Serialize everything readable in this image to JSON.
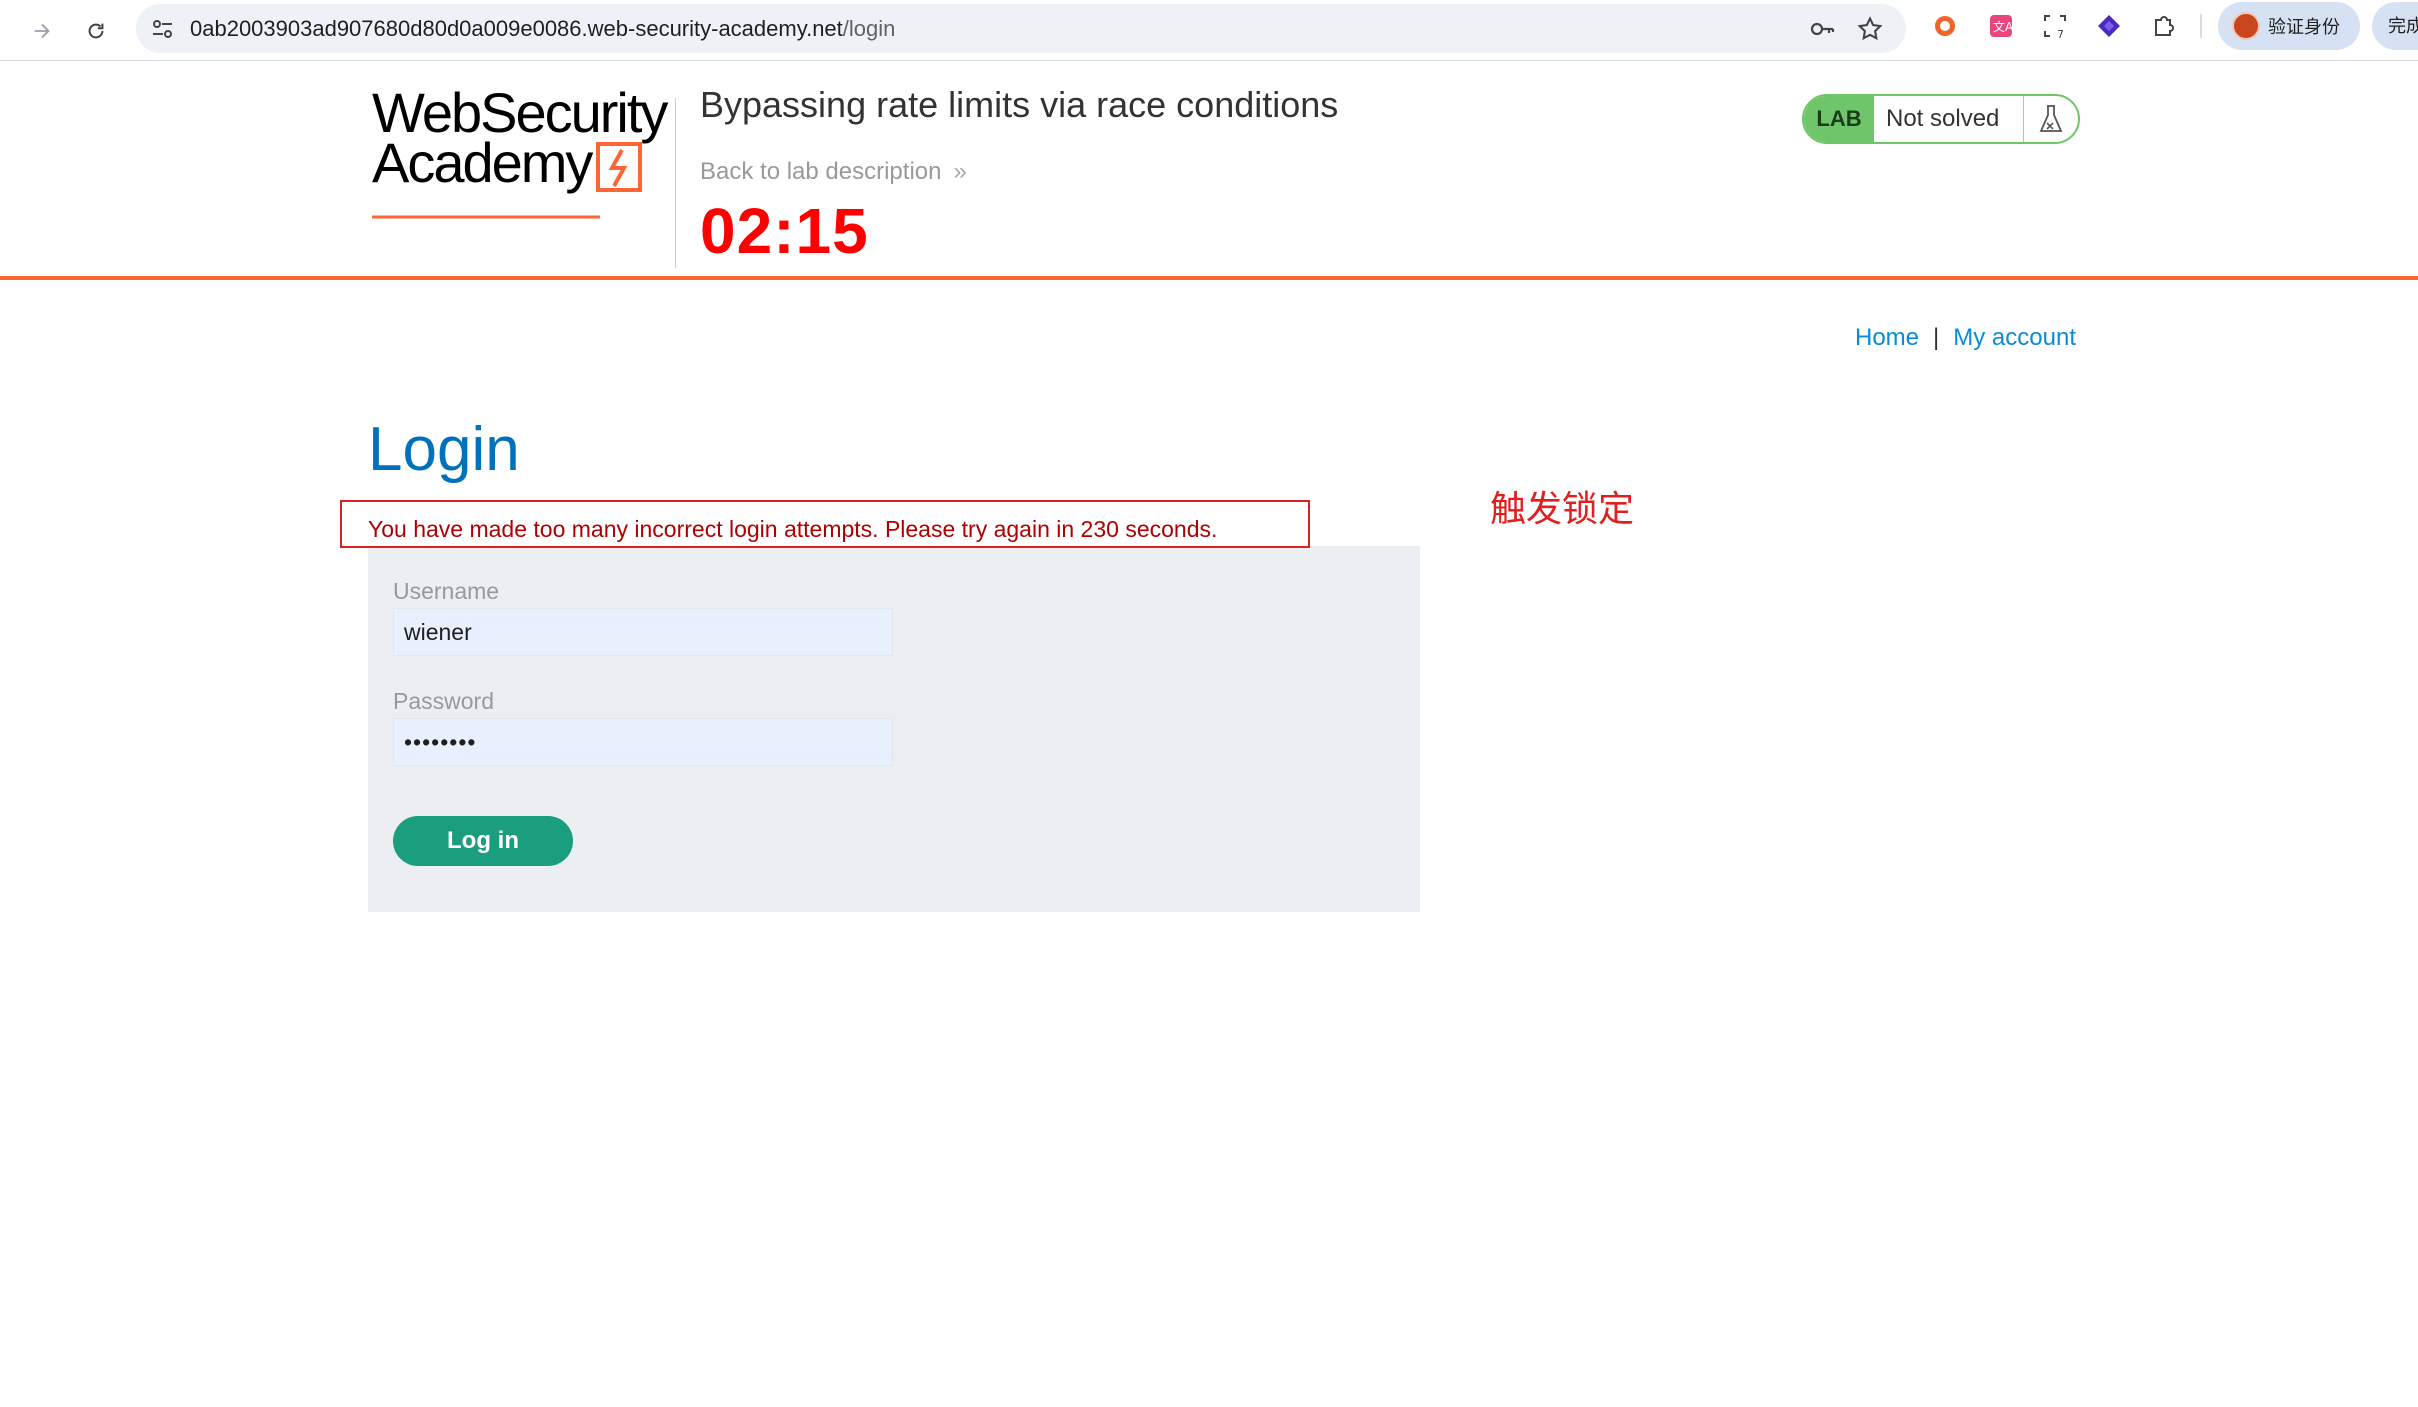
{
  "browser": {
    "url_host": "0ab2003903ad907680d80d0a009e0086.web-security-academy.net",
    "url_path": "/login",
    "profile_label": "验证身份",
    "done_label": "完成"
  },
  "header": {
    "logo_line1": "WebSecurity",
    "logo_line2": "Academy",
    "lab_title": "Bypassing rate limits via race conditions",
    "back_link": "Back to lab description",
    "timer": "02:15",
    "lab_badge": "LAB",
    "lab_state": "Not solved",
    "accent_color": "#ff6633",
    "badge_color": "#6ec56a"
  },
  "nav": {
    "home": "Home",
    "separator": "|",
    "my_account": "My account"
  },
  "login": {
    "heading": "Login",
    "error_message": "You have made too many incorrect login attempts. Please try again in 230 seconds.",
    "username_label": "Username",
    "username_value": "wiener",
    "password_label": "Password",
    "password_value": "••••••••",
    "submit_label": "Log in",
    "button_color": "#1b9e7e"
  },
  "annotation": {
    "text": "触发锁定",
    "color": "#e0201f"
  }
}
